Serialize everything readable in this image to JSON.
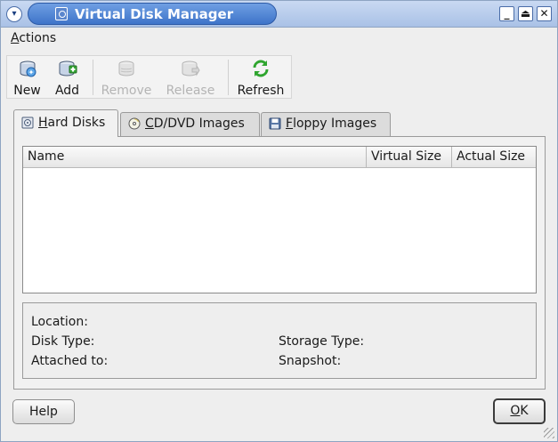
{
  "window": {
    "title": "Virtual Disk Manager",
    "controls": {
      "minimize": "_",
      "maximize": "⏏",
      "close": "✕",
      "menu": "▾"
    }
  },
  "menubar": {
    "actions_prefix": "A",
    "actions_rest": "ctions"
  },
  "toolbar": {
    "new": "New",
    "add": "Add",
    "remove": "Remove",
    "release": "Release",
    "refresh": "Refresh"
  },
  "tabs": [
    {
      "prefix": "",
      "mnemonic": "H",
      "rest": "ard Disks",
      "icon": "hard-disk-icon",
      "active": true
    },
    {
      "prefix": "",
      "mnemonic": "C",
      "rest": "D/DVD Images",
      "icon": "cd-dvd-icon",
      "active": false
    },
    {
      "prefix": "",
      "mnemonic": "F",
      "rest": "loppy Images",
      "icon": "floppy-icon",
      "active": false
    }
  ],
  "table": {
    "columns": [
      "Name",
      "Virtual Size",
      "Actual Size"
    ],
    "rows": []
  },
  "details": {
    "location": "Location:",
    "disk_type": "Disk Type:",
    "storage_type": "Storage Type:",
    "attached_to": "Attached to:",
    "snapshot": "Snapshot:"
  },
  "buttons": {
    "help": "Help",
    "ok_mnemonic": "O",
    "ok_rest": "K"
  },
  "colors": {
    "titlebar": "#3e74c9",
    "accent": "#2d5aa6",
    "refresh_green": "#2fa52f"
  }
}
